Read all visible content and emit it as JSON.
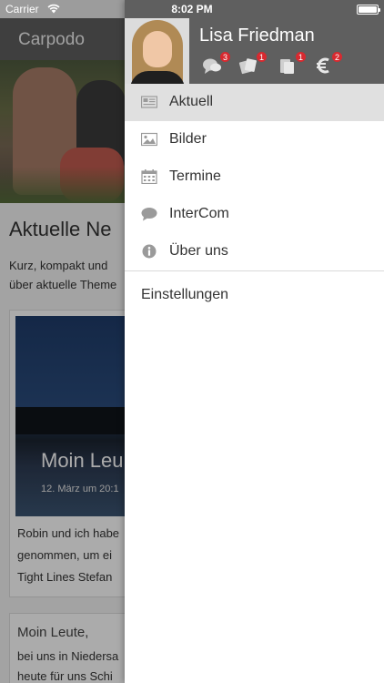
{
  "status_bar": {
    "carrier": "Carrier",
    "time": "8:02 PM"
  },
  "background": {
    "nav_title": "Carpodo",
    "heading": "Aktuelle Ne",
    "intro_line1": "Kurz, kompakt und",
    "intro_line2": "über aktuelle Theme",
    "card": {
      "title": "Moin Leu",
      "date": "12. März um 20:1",
      "text_line1": "Robin und ich habe",
      "text_line2": "genommen, um ei",
      "text_line3": "Tight Lines Stefan"
    },
    "card2": {
      "title": "Moin Leute,",
      "text_line1": "bei uns in Niedersa",
      "text_line2": "heute für uns Schi"
    }
  },
  "drawer": {
    "user_name": "Lisa Friedman",
    "badges": [
      {
        "icon": "chat-bubbles-icon",
        "count": "3"
      },
      {
        "icon": "tickets-icon",
        "count": "1"
      },
      {
        "icon": "documents-icon",
        "count": "1"
      },
      {
        "icon": "euro-icon",
        "count": "2"
      }
    ],
    "menu": [
      {
        "label": "Aktuell",
        "icon": "newspaper-icon",
        "active": true
      },
      {
        "label": "Bilder",
        "icon": "image-icon",
        "active": false
      },
      {
        "label": "Termine",
        "icon": "calendar-icon",
        "active": false
      },
      {
        "label": "InterCom",
        "icon": "speech-bubble-icon",
        "active": false
      },
      {
        "label": "Über uns",
        "icon": "info-icon",
        "active": false
      }
    ],
    "settings_label": "Einstellungen"
  },
  "colors": {
    "header_gray": "#5f5f5f",
    "badge_red": "#d8292f",
    "active_row": "#e0e0e0",
    "icon_gray": "#9a9a9a"
  }
}
